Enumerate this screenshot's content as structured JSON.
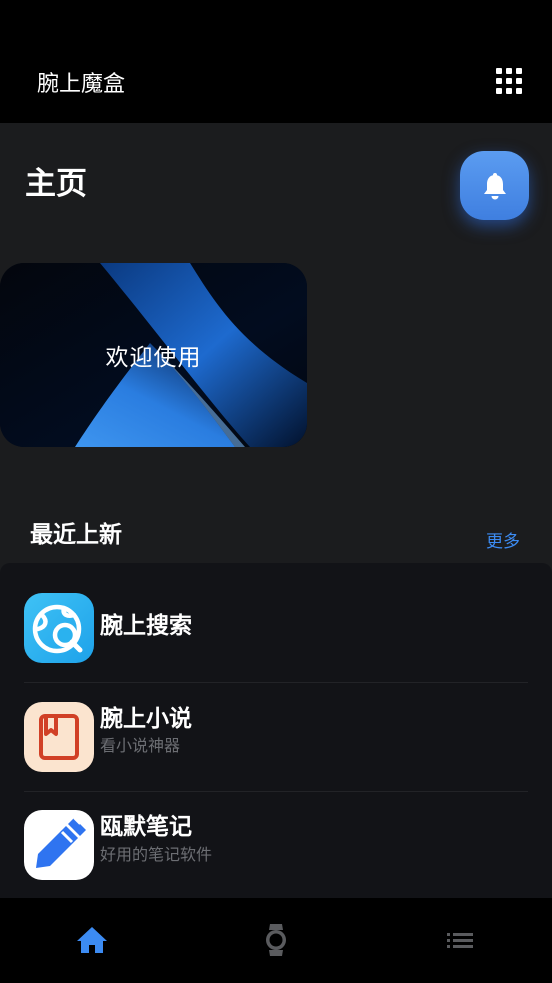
{
  "appbar": {
    "title": "腕上魔盒",
    "menu_icon": "grid-icon"
  },
  "home": {
    "title": "主页",
    "notification_icon": "bell-icon"
  },
  "banner": {
    "text": "欢迎使用"
  },
  "recent": {
    "title": "最近上新",
    "more_label": "更多",
    "items": [
      {
        "name": "腕上搜索",
        "description": "",
        "icon": "search-globe-icon"
      },
      {
        "name": "腕上小说",
        "description": "看小说神器",
        "icon": "book-icon"
      },
      {
        "name": "瓯默笔记",
        "description": "好用的笔记软件",
        "icon": "pen-icon"
      }
    ]
  },
  "bottom_nav": [
    {
      "id": "home",
      "icon": "home-icon",
      "active": true
    },
    {
      "id": "watch",
      "icon": "watch-icon",
      "active": false
    },
    {
      "id": "list",
      "icon": "list-icon",
      "active": false
    }
  ],
  "colors": {
    "accent": "#3c8bf2",
    "background": "#1b1c1e",
    "panel": "#121317",
    "bar": "#000000"
  }
}
